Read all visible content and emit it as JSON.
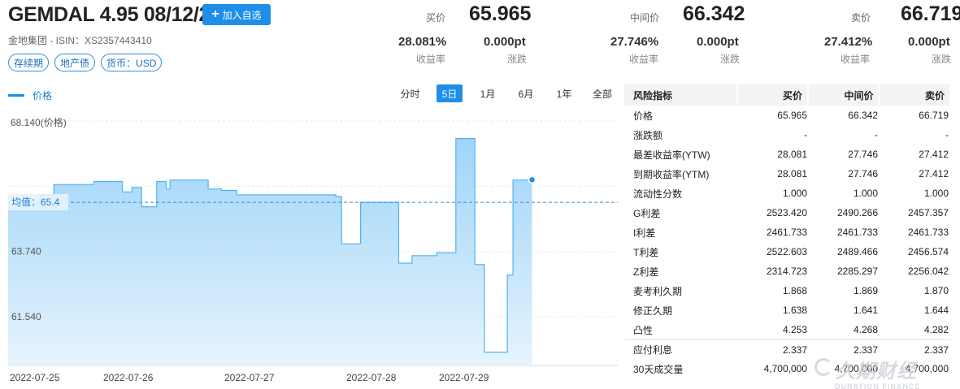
{
  "header": {
    "title": "GEMDAL 4.95 08/12/24",
    "watch_label": "加入自选",
    "sub_info": "金地集团 - ISIN：XS2357443410",
    "tags": [
      "存续期",
      "地产债",
      "货币：USD"
    ]
  },
  "quotes": {
    "bid": {
      "label": "买价",
      "price": "65.965",
      "yield": "28.081%",
      "yield_label": "收益率",
      "change": "0.000pt",
      "change_label": "涨跌"
    },
    "mid": {
      "label": "中间价",
      "price": "66.342",
      "yield": "27.746%",
      "yield_label": "收益率",
      "change": "0.000pt",
      "change_label": "涨跌"
    },
    "ask": {
      "label": "卖价",
      "price": "66.719",
      "yield": "27.412%",
      "yield_label": "收益率",
      "change": "0.000pt",
      "change_label": "涨跌"
    }
  },
  "chart_controls": {
    "legend_label": "价格",
    "ranges": [
      "分时",
      "5日",
      "1月",
      "6月",
      "1年",
      "全部"
    ],
    "active_range": "5日"
  },
  "chart_data": {
    "type": "area",
    "series_name": "价格",
    "y_axis_title": "68.140(价格)",
    "y_ticks": [
      "68.140",
      "63.740",
      "61.540"
    ],
    "average_label": "均值：65.4",
    "average_value": 65.4,
    "x_labels": [
      "2022-07-25",
      "2022-07-26",
      "2022-07-27",
      "2022-07-28",
      "2022-07-29"
    ],
    "ylim": [
      59.9,
      68.14
    ],
    "points": [
      [
        0,
        65.25
      ],
      [
        0.03,
        65.25
      ],
      [
        0.03,
        65.35
      ],
      [
        0.08,
        65.35
      ],
      [
        0.08,
        65.6
      ],
      [
        0.12,
        65.6
      ],
      [
        0.12,
        65.35
      ],
      [
        0.17,
        65.35
      ],
      [
        0.17,
        65.65
      ],
      [
        0.24,
        65.65
      ],
      [
        0.24,
        66.0
      ],
      [
        0.45,
        66.0
      ],
      [
        0.45,
        66.1
      ],
      [
        0.6,
        66.1
      ],
      [
        0.6,
        65.75
      ],
      [
        0.65,
        65.75
      ],
      [
        0.65,
        65.9
      ],
      [
        0.7,
        65.9
      ],
      [
        0.7,
        65.25
      ],
      [
        0.78,
        65.25
      ],
      [
        0.78,
        66.1
      ],
      [
        0.83,
        66.1
      ],
      [
        0.83,
        65.85
      ],
      [
        0.85,
        65.85
      ],
      [
        0.85,
        66.15
      ],
      [
        1.05,
        66.15
      ],
      [
        1.05,
        65.85
      ],
      [
        1.12,
        65.85
      ],
      [
        1.12,
        65.8
      ],
      [
        1.2,
        65.8
      ],
      [
        1.2,
        65.65
      ],
      [
        1.72,
        65.65
      ],
      [
        1.72,
        65.6
      ],
      [
        1.75,
        65.6
      ],
      [
        1.75,
        64.0
      ],
      [
        1.85,
        64.0
      ],
      [
        1.85,
        65.4
      ],
      [
        2.05,
        65.4
      ],
      [
        2.05,
        63.35
      ],
      [
        2.12,
        63.35
      ],
      [
        2.12,
        63.6
      ],
      [
        2.25,
        63.6
      ],
      [
        2.25,
        63.7
      ],
      [
        2.35,
        63.7
      ],
      [
        2.35,
        67.55
      ],
      [
        2.45,
        67.55
      ],
      [
        2.45,
        63.3
      ],
      [
        2.5,
        63.3
      ],
      [
        2.5,
        60.35
      ],
      [
        2.62,
        60.35
      ],
      [
        2.62,
        62.95
      ],
      [
        2.65,
        62.95
      ],
      [
        2.65,
        66.15
      ],
      [
        2.75,
        66.15
      ],
      [
        2.75,
        66.16
      ]
    ],
    "x_max": 3.2
  },
  "risk_table": {
    "headers": [
      "风险指标",
      "买价",
      "中间价",
      "卖价"
    ],
    "rows": [
      [
        "价格",
        "65.965",
        "66.342",
        "66.719"
      ],
      [
        "涨跌额",
        "-",
        "-",
        "-"
      ],
      [
        "最差收益率(YTW)",
        "28.081",
        "27.746",
        "27.412"
      ],
      [
        "到期收益率(YTM)",
        "28.081",
        "27.746",
        "27.412"
      ],
      [
        "流动性分数",
        "1.000",
        "1.000",
        "1.000"
      ],
      [
        "G利差",
        "2523.420",
        "2490.266",
        "2457.357"
      ],
      [
        "I利差",
        "2461.733",
        "2461.733",
        "2461.733"
      ],
      [
        "T利差",
        "2522.603",
        "2489.466",
        "2456.574"
      ],
      [
        "Z利差",
        "2314.723",
        "2285.297",
        "2256.042"
      ],
      [
        "麦考利久期",
        "1.868",
        "1.869",
        "1.870"
      ],
      [
        "修正久期",
        "1.638",
        "1.641",
        "1.644"
      ],
      [
        "凸性",
        "4.253",
        "4.268",
        "4.282"
      ],
      [
        "应付利息",
        "2.337",
        "2.337",
        "2.337"
      ],
      [
        "30天成交量",
        "4,700,000",
        "4,700,000",
        "4,700,000"
      ]
    ]
  },
  "watermark": {
    "cn": "久期财经",
    "en": "DURATION FINANCE"
  }
}
